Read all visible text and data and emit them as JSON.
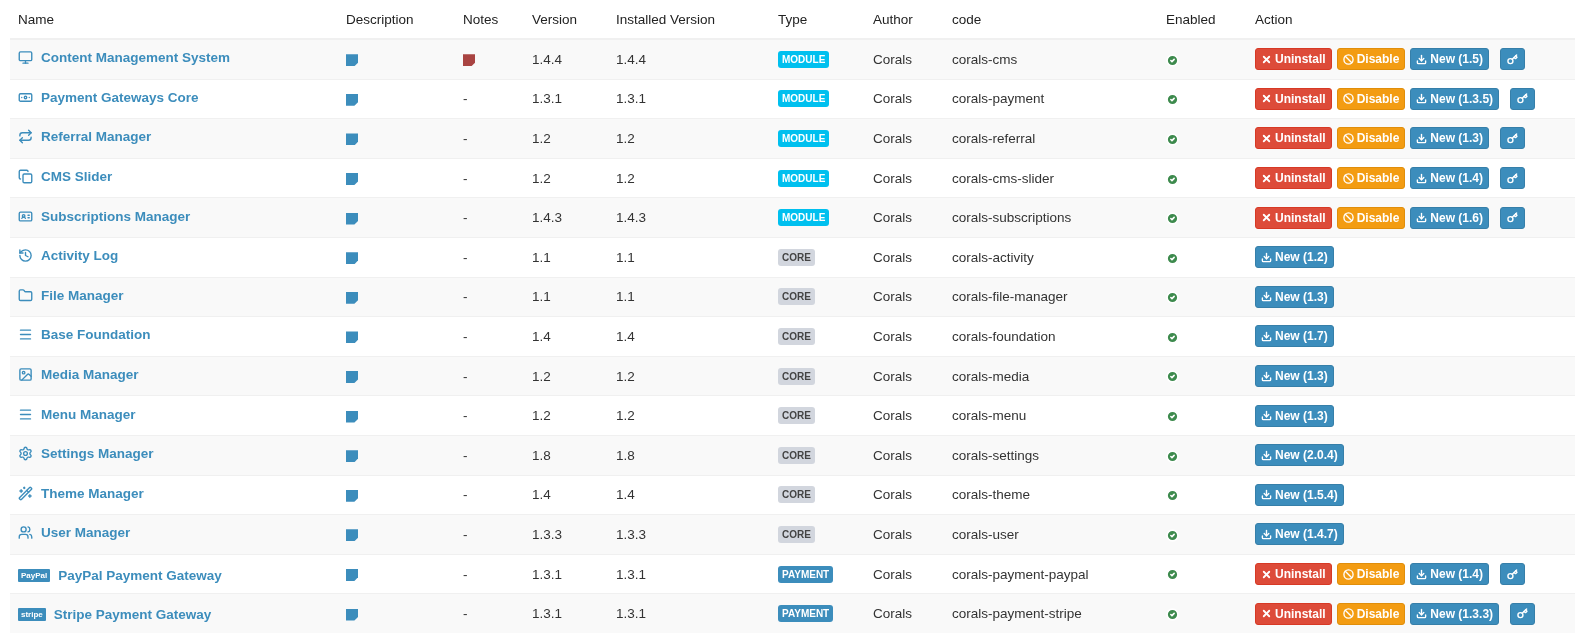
{
  "columns": [
    "Name",
    "Description",
    "Notes",
    "Version",
    "Installed Version",
    "Type",
    "Author",
    "code",
    "Enabled",
    "Action"
  ],
  "rows": [
    {
      "name": "Content Management System",
      "has_note": true,
      "version": "1.4.4",
      "installed": "1.4.4",
      "type": {
        "kind": "module",
        "label": "MODULE"
      },
      "author": "Corals",
      "code": "corals-cms",
      "enabled": true,
      "actions": [
        {
          "kind": "uninstall",
          "label": "Uninstall"
        },
        {
          "kind": "disable",
          "label": "Disable"
        },
        {
          "kind": "new",
          "label": "New (1.5)"
        },
        {
          "kind": "key"
        }
      ]
    },
    {
      "name": "Payment Gateways Core",
      "has_note": false,
      "notes": "-",
      "version": "1.3.1",
      "installed": "1.3.1",
      "type": {
        "kind": "module",
        "label": "MODULE"
      },
      "author": "Corals",
      "code": "corals-payment",
      "enabled": true,
      "actions": [
        {
          "kind": "uninstall",
          "label": "Uninstall"
        },
        {
          "kind": "disable",
          "label": "Disable"
        },
        {
          "kind": "new",
          "label": "New (1.3.5)"
        },
        {
          "kind": "key"
        }
      ]
    },
    {
      "name": "Referral Manager",
      "has_note": false,
      "notes": "-",
      "version": "1.2",
      "installed": "1.2",
      "type": {
        "kind": "module",
        "label": "MODULE"
      },
      "author": "Corals",
      "code": "corals-referral",
      "enabled": true,
      "actions": [
        {
          "kind": "uninstall",
          "label": "Uninstall"
        },
        {
          "kind": "disable",
          "label": "Disable"
        },
        {
          "kind": "new",
          "label": "New (1.3)"
        },
        {
          "kind": "key"
        }
      ]
    },
    {
      "name": "CMS Slider",
      "has_note": false,
      "notes": "-",
      "version": "1.2",
      "installed": "1.2",
      "type": {
        "kind": "module",
        "label": "MODULE"
      },
      "author": "Corals",
      "code": "corals-cms-slider",
      "enabled": true,
      "actions": [
        {
          "kind": "uninstall",
          "label": "Uninstall"
        },
        {
          "kind": "disable",
          "label": "Disable"
        },
        {
          "kind": "new",
          "label": "New (1.4)"
        },
        {
          "kind": "key"
        }
      ]
    },
    {
      "name": "Subscriptions Manager",
      "has_note": false,
      "notes": "-",
      "version": "1.4.3",
      "installed": "1.4.3",
      "type": {
        "kind": "module",
        "label": "MODULE"
      },
      "author": "Corals",
      "code": "corals-subscriptions",
      "enabled": true,
      "actions": [
        {
          "kind": "uninstall",
          "label": "Uninstall"
        },
        {
          "kind": "disable",
          "label": "Disable"
        },
        {
          "kind": "new",
          "label": "New (1.6)"
        },
        {
          "kind": "key"
        }
      ]
    },
    {
      "name": "Activity Log",
      "has_note": false,
      "notes": "-",
      "version": "1.1",
      "installed": "1.1",
      "type": {
        "kind": "core",
        "label": "CORE"
      },
      "author": "Corals",
      "code": "corals-activity",
      "enabled": true,
      "actions": [
        {
          "kind": "new",
          "label": "New (1.2)"
        }
      ]
    },
    {
      "name": "File Manager",
      "has_note": false,
      "notes": "-",
      "version": "1.1",
      "installed": "1.1",
      "type": {
        "kind": "core",
        "label": "CORE"
      },
      "author": "Corals",
      "code": "corals-file-manager",
      "enabled": true,
      "actions": [
        {
          "kind": "new",
          "label": "New (1.3)"
        }
      ]
    },
    {
      "name": "Base Foundation",
      "has_note": false,
      "notes": "-",
      "version": "1.4",
      "installed": "1.4",
      "type": {
        "kind": "core",
        "label": "CORE"
      },
      "author": "Corals",
      "code": "corals-foundation",
      "enabled": true,
      "actions": [
        {
          "kind": "new",
          "label": "New (1.7)"
        }
      ]
    },
    {
      "name": "Media Manager",
      "has_note": false,
      "notes": "-",
      "version": "1.2",
      "installed": "1.2",
      "type": {
        "kind": "core",
        "label": "CORE"
      },
      "author": "Corals",
      "code": "corals-media",
      "enabled": true,
      "actions": [
        {
          "kind": "new",
          "label": "New (1.3)"
        }
      ]
    },
    {
      "name": "Menu Manager",
      "has_note": false,
      "notes": "-",
      "version": "1.2",
      "installed": "1.2",
      "type": {
        "kind": "core",
        "label": "CORE"
      },
      "author": "Corals",
      "code": "corals-menu",
      "enabled": true,
      "actions": [
        {
          "kind": "new",
          "label": "New (1.3)"
        }
      ]
    },
    {
      "name": "Settings Manager",
      "has_note": false,
      "notes": "-",
      "version": "1.8",
      "installed": "1.8",
      "type": {
        "kind": "core",
        "label": "CORE"
      },
      "author": "Corals",
      "code": "corals-settings",
      "enabled": true,
      "actions": [
        {
          "kind": "new",
          "label": "New (2.0.4)"
        }
      ]
    },
    {
      "name": "Theme Manager",
      "has_note": false,
      "notes": "-",
      "version": "1.4",
      "installed": "1.4",
      "type": {
        "kind": "core",
        "label": "CORE"
      },
      "author": "Corals",
      "code": "corals-theme",
      "enabled": true,
      "actions": [
        {
          "kind": "new",
          "label": "New (1.5.4)"
        }
      ]
    },
    {
      "name": "User Manager",
      "has_note": false,
      "notes": "-",
      "version": "1.3.3",
      "installed": "1.3.3",
      "type": {
        "kind": "core",
        "label": "CORE"
      },
      "author": "Corals",
      "code": "corals-user",
      "enabled": true,
      "actions": [
        {
          "kind": "new",
          "label": "New (1.4.7)"
        }
      ]
    },
    {
      "logo_text": "PayPal",
      "name": "PayPal Payment Gateway",
      "has_note": false,
      "notes": "-",
      "version": "1.3.1",
      "installed": "1.3.1",
      "type": {
        "kind": "payment",
        "label": "PAYMENT"
      },
      "author": "Corals",
      "code": "corals-payment-paypal",
      "enabled": true,
      "actions": [
        {
          "kind": "uninstall",
          "label": "Uninstall"
        },
        {
          "kind": "disable",
          "label": "Disable"
        },
        {
          "kind": "new",
          "label": "New (1.4)"
        },
        {
          "kind": "key"
        }
      ]
    },
    {
      "logo_text": "stripe",
      "name": "Stripe Payment Gateway",
      "has_note": false,
      "notes": "-",
      "version": "1.3.1",
      "installed": "1.3.1",
      "type": {
        "kind": "payment",
        "label": "PAYMENT"
      },
      "author": "Corals",
      "code": "corals-payment-stripe",
      "enabled": true,
      "actions": [
        {
          "kind": "uninstall",
          "label": "Uninstall"
        },
        {
          "kind": "disable",
          "label": "Disable"
        },
        {
          "kind": "new",
          "label": "New (1.3.3)"
        },
        {
          "kind": "key"
        }
      ]
    }
  ]
}
